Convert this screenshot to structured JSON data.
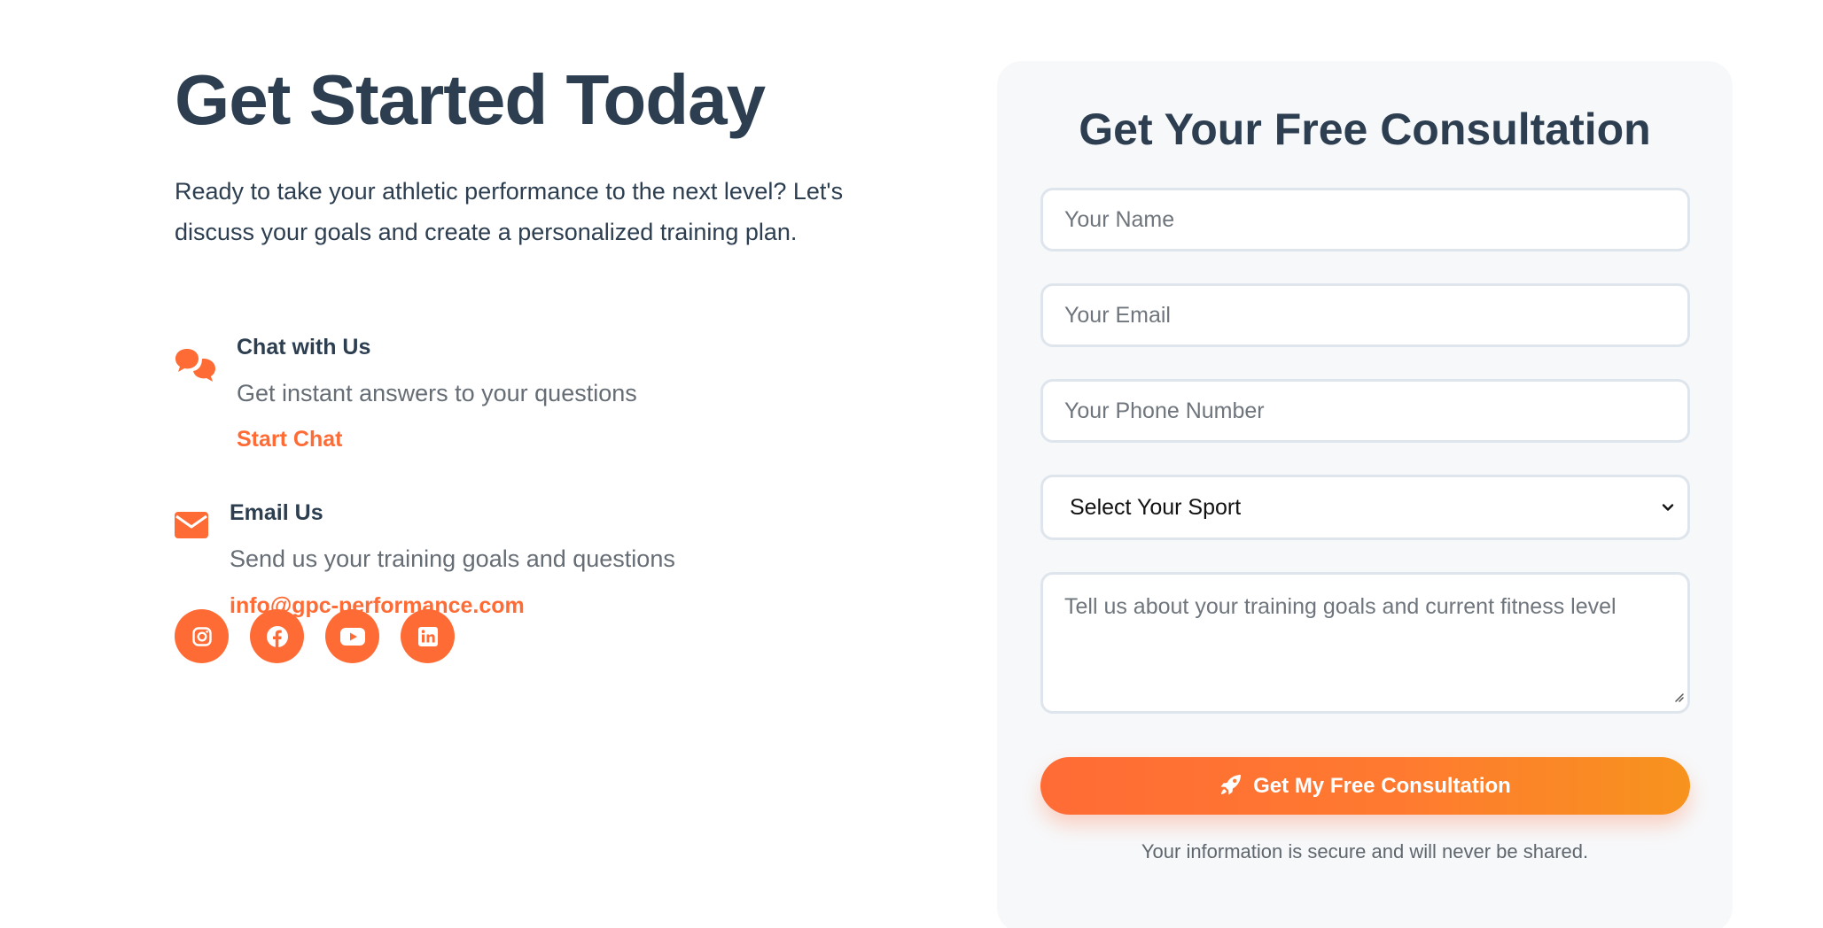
{
  "hero": {
    "title": "Get Started Today",
    "intro": "Ready to take your athletic performance to the next level? Let's discuss your goals and create a personalized training plan."
  },
  "contacts": [
    {
      "icon": "chat-icon",
      "title": "Chat with Us",
      "description": "Get instant answers to your questions",
      "link_label": "Start Chat"
    },
    {
      "icon": "envelope-icon",
      "title": "Email Us",
      "description": "Send us your training goals and questions",
      "link_label": "info@gpc-performance.com"
    }
  ],
  "socials": [
    {
      "icon": "instagram-icon"
    },
    {
      "icon": "facebook-icon"
    },
    {
      "icon": "youtube-icon"
    },
    {
      "icon": "linkedin-icon"
    }
  ],
  "form": {
    "title": "Get Your Free Consultation",
    "name_placeholder": "Your Name",
    "email_placeholder": "Your Email",
    "phone_placeholder": "Your Phone Number",
    "sport_selected": "Select Your Sport",
    "goals_placeholder": "Tell us about your training goals and current fitness level",
    "submit_label": "Get My Free Consultation",
    "submit_icon": "rocket-icon",
    "secure_note": "Your information is secure and will never be shared."
  },
  "colors": {
    "accent": "#ff6b35",
    "accent_end": "#f7931e",
    "heading": "#2c3e50",
    "muted": "#666d75",
    "card_bg": "#f7f8fa",
    "field_border": "#dfe5ec"
  }
}
